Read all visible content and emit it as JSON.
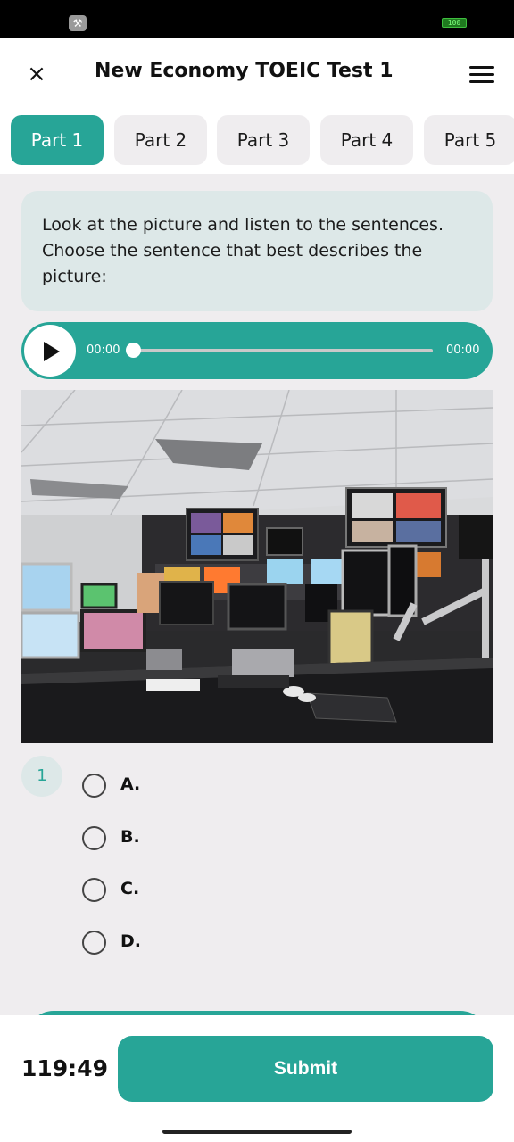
{
  "status_bar": {
    "tool_icon": "wrench-icon",
    "battery": "100"
  },
  "header": {
    "close_icon": "close-icon",
    "close_glyph": "×",
    "title": "New Economy TOEIC Test 1",
    "menu_icon": "hamburger-menu-icon"
  },
  "tabs": [
    {
      "label": "Part 1",
      "active": true
    },
    {
      "label": "Part 2",
      "active": false
    },
    {
      "label": "Part 3",
      "active": false
    },
    {
      "label": "Part 4",
      "active": false
    },
    {
      "label": "Part 5",
      "active": false
    }
  ],
  "prompt": {
    "text": "Look at the picture and listen to the sentences. Choose the sentence that best describes the picture:"
  },
  "audio": {
    "current_time": "00:00",
    "total_time": "00:00",
    "progress": 0,
    "play_icon": "play-icon"
  },
  "question": {
    "number": "1",
    "image_subject": "broadcast control room with monitors",
    "options": [
      {
        "label": "A."
      },
      {
        "label": "B."
      },
      {
        "label": "C."
      },
      {
        "label": "D."
      }
    ]
  },
  "footer": {
    "timer": "119:49",
    "submit_label": "Submit"
  },
  "colors": {
    "accent": "#27a597",
    "accent_light": "#dde8e8",
    "background": "#efedef",
    "tab_inactive": "#efedef"
  }
}
